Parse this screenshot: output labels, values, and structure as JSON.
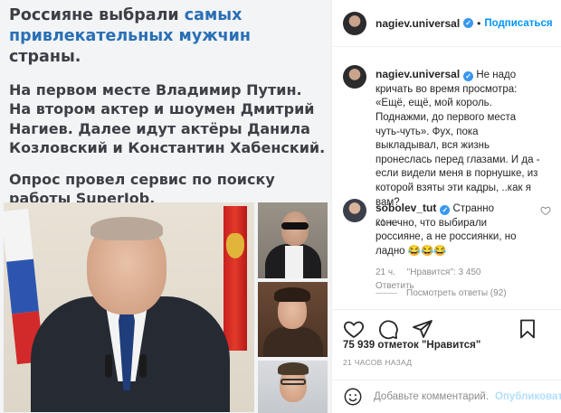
{
  "post_image": {
    "headline_prefix": "Россияне выбрали ",
    "headline_highlight": "самых привлекательных мужчин",
    "headline_suffix": " страны.",
    "paragraph1": "На первом месте Владимир Путин. На втором  актер и шоумен Дмитрий Нагиев. Далее идут актёры Данила Козловский и Константин Хабенский.",
    "paragraph2": "Опрос провел сервис по поиску работы SuperJob."
  },
  "header": {
    "username": "nagiev.universal",
    "follow_label": "Подписаться"
  },
  "comments": [
    {
      "username": "nagiev.universal",
      "text": "Не надо кричать во время просмотра: «Ещё, ещё, мой король. Поднажми, до первого места чуть-чуть». Фух, пока выкладывал, вся жизнь пронеслась перед глазами. И да - если видели меня в порнушке, из которой взяты эти кадры, ..как я вам?",
      "time": "21 ч."
    },
    {
      "username": "sobolev_tut",
      "text": "Странно конечно, что выбирали россияне, а не россиянки, но ладно 😂😂😂",
      "time": "21 ч.",
      "likes": "\"Нравится\": 3 450",
      "reply_label": "Ответить",
      "view_replies": "Посмотреть ответы (92)"
    }
  ],
  "stats": {
    "likes_count": "75 939",
    "likes_label": "отметок \"Нравится\"",
    "posted_ago": "21 ЧАСОВ НАЗАД"
  },
  "composer": {
    "placeholder": "Добавьте комментарий...",
    "publish_label": "Опубликовать"
  },
  "colors": {
    "accent": "#0095f6",
    "highlight_text": "#2a6fb5",
    "publish_disabled": "#b2dffc"
  },
  "icons": [
    "heart-icon",
    "comment-icon",
    "share-icon",
    "bookmark-icon",
    "emoji-icon",
    "verified-icon"
  ]
}
